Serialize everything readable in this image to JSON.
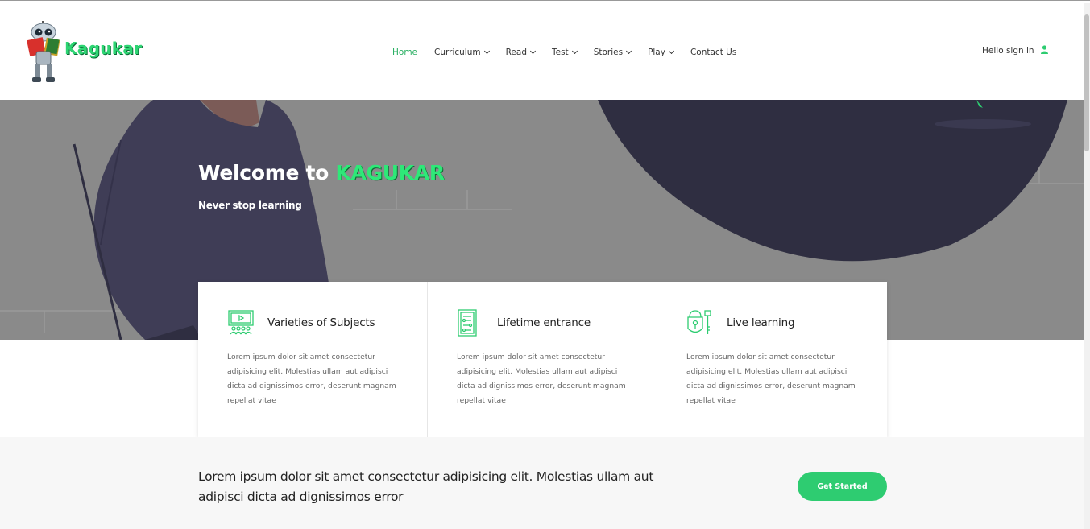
{
  "brand": {
    "name": "Kagukar",
    "logo_icon": "robot-reading-book-icon"
  },
  "nav": {
    "items": [
      {
        "label": "Home",
        "active": true,
        "dropdown": false
      },
      {
        "label": "Curriculum",
        "active": false,
        "dropdown": true
      },
      {
        "label": "Read",
        "active": false,
        "dropdown": true
      },
      {
        "label": "Test",
        "active": false,
        "dropdown": true
      },
      {
        "label": "Stories",
        "active": false,
        "dropdown": true
      },
      {
        "label": "Play",
        "active": false,
        "dropdown": true
      },
      {
        "label": "Contact Us",
        "active": false,
        "dropdown": false
      }
    ],
    "signin_label": "Hello sign in",
    "signin_icon": "user-icon"
  },
  "hero": {
    "title_prefix": "Welcome to",
    "title_brand": "KAGUKAR",
    "subtitle": "Never stop learning"
  },
  "features": [
    {
      "icon": "monitor-classroom-icon",
      "title": "Varieties of Subjects",
      "text": "Lorem ipsum dolor sit amet consectetur adipisicing elit. Molestias ullam aut adipisci dicta ad dignissimos error, deserunt magnam repellat vitae"
    },
    {
      "icon": "door-panel-icon",
      "title": "Lifetime entrance",
      "text": "Lorem ipsum dolor sit amet consectetur adipisicing elit. Molestias ullam aut adipisci dicta ad dignissimos error, deserunt magnam repellat vitae"
    },
    {
      "icon": "lock-key-icon",
      "title": "Live learning",
      "text": "Lorem ipsum dolor sit amet consectetur adipisicing elit. Molestias ullam aut adipisci dicta ad dignissimos error, deserunt magnam repellat vitae"
    }
  ],
  "cta": {
    "text": "Lorem ipsum dolor sit amet consectetur adipisicing elit. Molestias ullam aut adipisci dicta ad dignissimos error",
    "button_label": "Get Started"
  },
  "colors": {
    "accent": "#2ecc71",
    "nav_active": "#27ae60",
    "hero_overlay": "#8a8a8a"
  }
}
